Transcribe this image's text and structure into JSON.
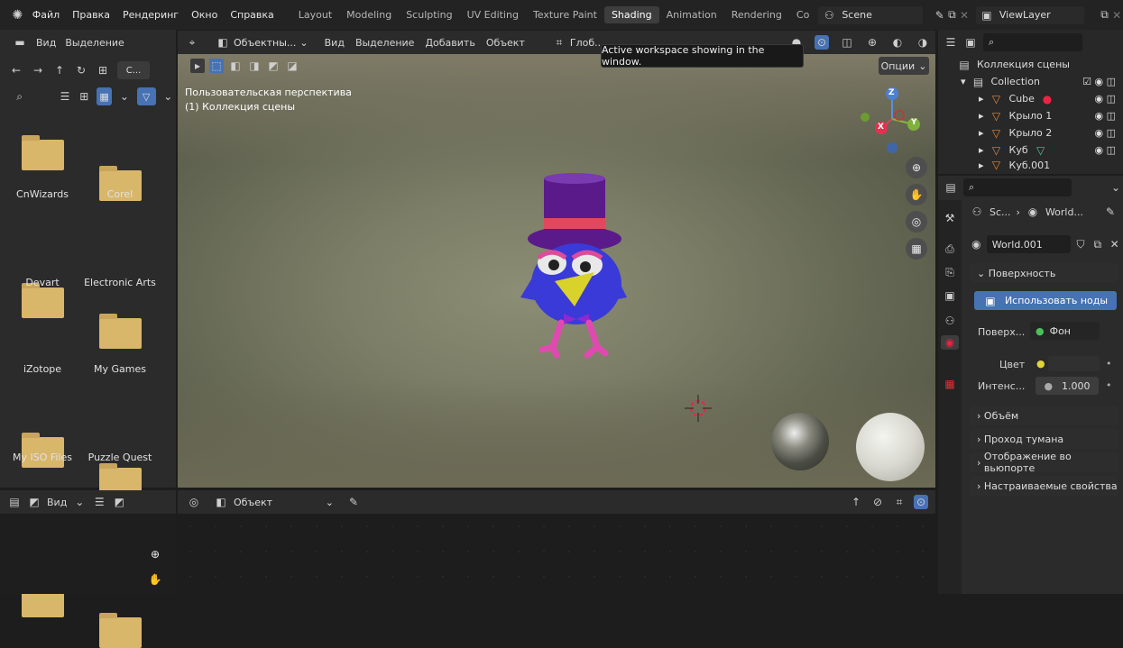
{
  "topbar": {
    "menus": [
      "Файл",
      "Правка",
      "Рендеринг",
      "Окно",
      "Справка"
    ],
    "workspaces": [
      "Layout",
      "Modeling",
      "Sculpting",
      "UV Editing",
      "Texture Paint",
      "Shading",
      "Animation",
      "Rendering",
      "Co"
    ],
    "active_workspace": "Shading",
    "scene": "Scene",
    "view_layer": "ViewLayer"
  },
  "tooltip": "Active workspace showing in the window.",
  "file_browser": {
    "header": [
      "Вид",
      "Выделение"
    ],
    "path": "C...",
    "items": [
      "CnWizards",
      "Corel",
      "Devart",
      "Electronic Arts",
      "iZotope",
      "My Games",
      "My ISO Files",
      "Puzzle Quest"
    ]
  },
  "viewport": {
    "mode": "Объектны...",
    "menus": [
      "Вид",
      "Выделение",
      "Добавить",
      "Объект"
    ],
    "transform": "Глоб...",
    "options": "Опции",
    "perspective": "Пользовательская перспектива",
    "collection_label": "(1) Коллекция сцены",
    "axes": {
      "z": "Z",
      "y": "Y",
      "x": "X"
    }
  },
  "node_editor": {
    "view": "Вид",
    "object": "Объект"
  },
  "outliner": {
    "scene_collection": "Коллекция сцены",
    "rows": [
      "Collection",
      "Cube",
      "Крыло 1",
      "Крыло 2",
      "Куб",
      "Куб.001"
    ]
  },
  "properties": {
    "breadcrumb": [
      "Sc...",
      "World..."
    ],
    "world": "World.001",
    "surface_section": "Поверхность",
    "use_nodes": "Использовать ноды",
    "surface_label": "Поверх...",
    "surface_value": "Фон",
    "color_label": "Цвет",
    "intensity_label": "Интенс...",
    "intensity_value": "1.000",
    "sections": [
      "Объём",
      "Проход тумана",
      "Отображение во вьюпорте",
      "Настраиваемые свойства"
    ]
  },
  "colors": {
    "accent": "#4772b3",
    "active_tab": "#3d3d3d",
    "folder": "#d8b66a"
  }
}
